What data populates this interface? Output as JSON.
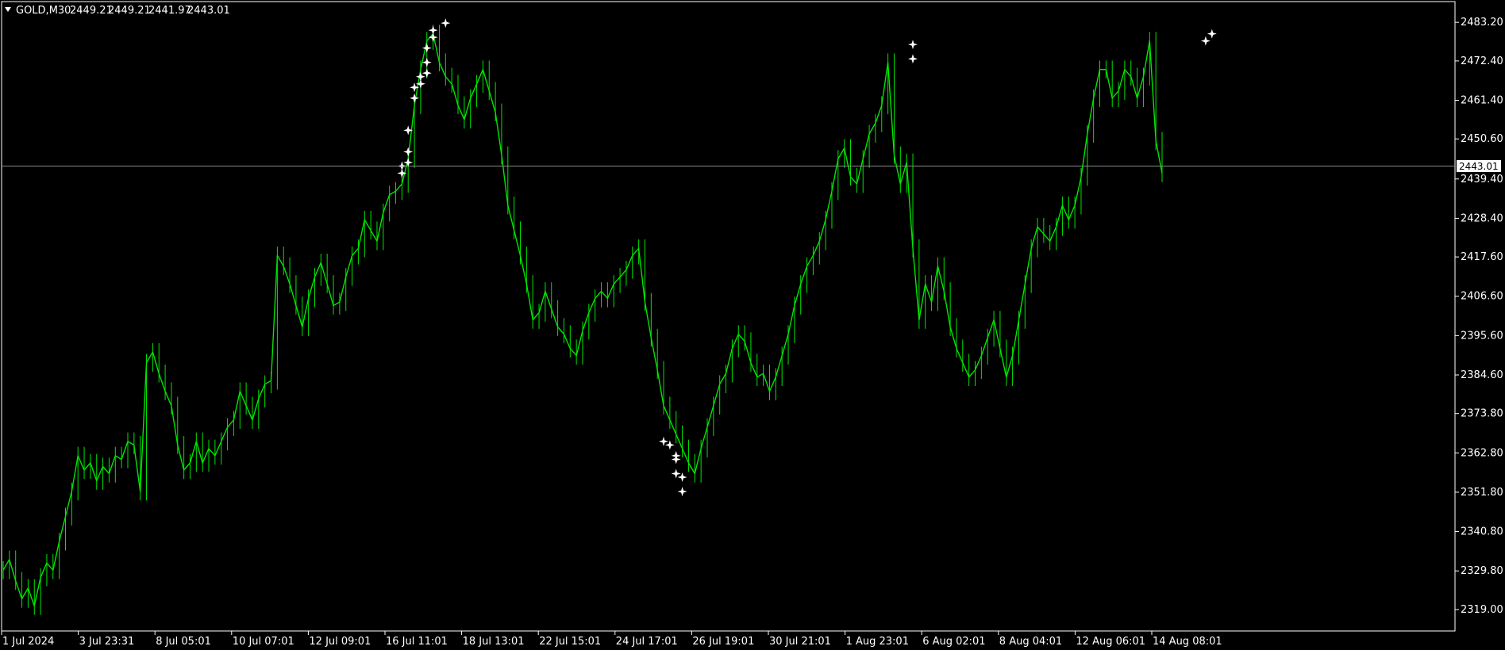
{
  "header": {
    "symbol": "GOLD,M30",
    "values": [
      "2449.21",
      "2449.21",
      "2441.97",
      "2443.01"
    ]
  },
  "colors": {
    "background": "#000000",
    "series": "#00e600",
    "marker": "#ffffff",
    "price_line": "#8a8a8a",
    "axis": "#ffffff"
  },
  "chart_data": {
    "type": "line",
    "title": "",
    "xlabel": "",
    "ylabel": "",
    "ylim": [
      2313.0,
      2489.0
    ],
    "y_ticks": [
      "2483.20",
      "2472.40",
      "2461.40",
      "2450.60",
      "2439.40",
      "2428.40",
      "2417.60",
      "2406.60",
      "2395.60",
      "2384.60",
      "2373.80",
      "2362.80",
      "2351.80",
      "2340.80",
      "2329.80",
      "2319.00"
    ],
    "x_tick_labels": [
      "1 Jul 2024",
      "3 Jul 23:31",
      "8 Jul 05:01",
      "10 Jul 07:01",
      "12 Jul 09:01",
      "16 Jul 11:01",
      "18 Jul 13:01",
      "22 Jul 15:01",
      "24 Jul 17:01",
      "26 Jul 19:01",
      "30 Jul 21:01",
      "1 Aug 23:01",
      "6 Aug 02:01",
      "8 Aug 04:01",
      "12 Aug 06:01",
      "14 Aug 08:01"
    ],
    "current_price": "2443.01",
    "grid": false,
    "series": [
      {
        "values": [
          2330,
          2333,
          2327,
          2322,
          2325,
          2320,
          2328,
          2332,
          2330,
          2338,
          2345,
          2352,
          2362,
          2358,
          2360,
          2355,
          2359,
          2357,
          2362,
          2361,
          2366,
          2365,
          2352,
          2388,
          2391,
          2385,
          2380,
          2376,
          2365,
          2358,
          2360,
          2366,
          2360,
          2364,
          2362,
          2366,
          2370,
          2372,
          2380,
          2376,
          2372,
          2378,
          2382,
          2383,
          2418,
          2415,
          2410,
          2404,
          2398,
          2406,
          2412,
          2416,
          2410,
          2404,
          2405,
          2412,
          2418,
          2420,
          2428,
          2425,
          2422,
          2430,
          2435,
          2436,
          2438,
          2445,
          2460,
          2470,
          2478,
          2480,
          2472,
          2468,
          2466,
          2460,
          2456,
          2462,
          2466,
          2470,
          2464,
          2458,
          2446,
          2432,
          2425,
          2418,
          2410,
          2400,
          2402,
          2408,
          2403,
          2398,
          2396,
          2392,
          2390,
          2397,
          2402,
          2406,
          2408,
          2406,
          2410,
          2412,
          2414,
          2418,
          2420,
          2405,
          2395,
          2386,
          2376,
          2372,
          2368,
          2364,
          2360,
          2357,
          2364,
          2370,
          2376,
          2382,
          2385,
          2392,
          2396,
          2394,
          2388,
          2384,
          2385,
          2380,
          2384,
          2390,
          2396,
          2404,
          2410,
          2415,
          2418,
          2422,
          2428,
          2436,
          2445,
          2448,
          2440,
          2438,
          2445,
          2452,
          2455,
          2460,
          2472,
          2446,
          2438,
          2444,
          2420,
          2400,
          2410,
          2405,
          2415,
          2408,
          2398,
          2392,
          2388,
          2384,
          2386,
          2390,
          2395,
          2400,
          2392,
          2384,
          2390,
          2400,
          2410,
          2420,
          2426,
          2424,
          2422,
          2426,
          2432,
          2428,
          2432,
          2440,
          2452,
          2462,
          2470,
          2470,
          2462,
          2464,
          2470,
          2468,
          2462,
          2468,
          2478,
          2450,
          2441
        ]
      }
    ],
    "markers": [
      {
        "i": 64,
        "y": 2441
      },
      {
        "i": 64,
        "y": 2443
      },
      {
        "i": 65,
        "y": 2444
      },
      {
        "i": 65,
        "y": 2447
      },
      {
        "i": 65,
        "y": 2453
      },
      {
        "i": 66,
        "y": 2462
      },
      {
        "i": 66,
        "y": 2465
      },
      {
        "i": 67,
        "y": 2466
      },
      {
        "i": 67,
        "y": 2468
      },
      {
        "i": 68,
        "y": 2469
      },
      {
        "i": 68,
        "y": 2472
      },
      {
        "i": 68,
        "y": 2476
      },
      {
        "i": 69,
        "y": 2479
      },
      {
        "i": 69,
        "y": 2481
      },
      {
        "i": 71,
        "y": 2483
      },
      {
        "i": 106,
        "y": 2366
      },
      {
        "i": 107,
        "y": 2365
      },
      {
        "i": 108,
        "y": 2362
      },
      {
        "i": 108,
        "y": 2361
      },
      {
        "i": 108,
        "y": 2357
      },
      {
        "i": 109,
        "y": 2356
      },
      {
        "i": 109,
        "y": 2352
      },
      {
        "i": 146,
        "y": 2473
      },
      {
        "i": 146,
        "y": 2477
      },
      {
        "i": 193,
        "y": 2478
      },
      {
        "i": 194,
        "y": 2480
      }
    ]
  }
}
